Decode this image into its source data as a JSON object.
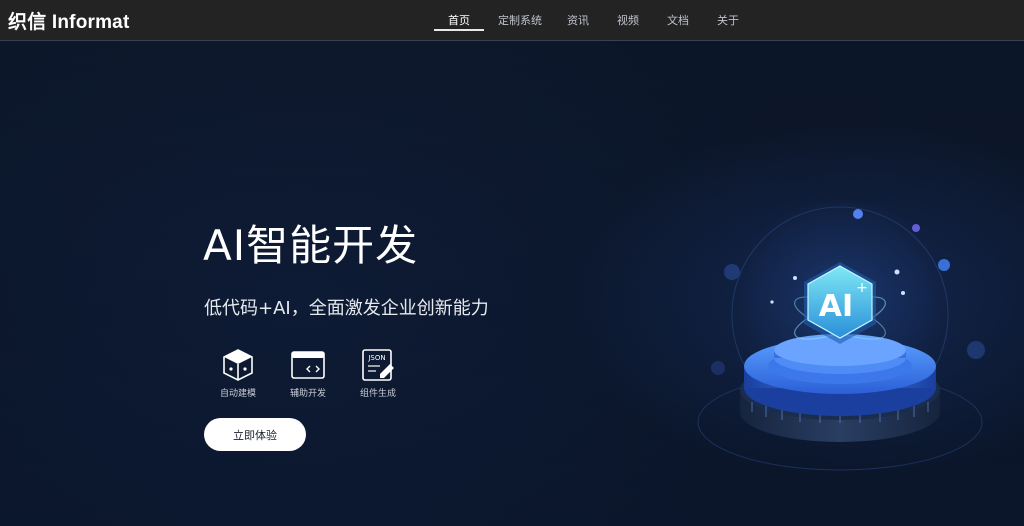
{
  "brand": {
    "logo_text": "织信 Informat"
  },
  "nav": {
    "items": [
      {
        "label": "首页",
        "active": true
      },
      {
        "label": "定制系统",
        "active": false
      },
      {
        "label": "资讯",
        "active": false
      },
      {
        "label": "视频",
        "active": false
      },
      {
        "label": "文档",
        "active": false
      },
      {
        "label": "关于",
        "active": false
      }
    ]
  },
  "hero": {
    "title": "AI智能开发",
    "subtitle": "低代码+AI，全面激发企业创新能力",
    "features": [
      {
        "label": "自动建模",
        "icon": "cube-icon"
      },
      {
        "label": "辅助开发",
        "icon": "code-window-icon"
      },
      {
        "label": "组件生成",
        "icon": "json-doc-icon"
      }
    ],
    "cta_label": "立即体验",
    "badge_text": "AI",
    "badge_plus": "+"
  },
  "colors": {
    "background": "#0b1426",
    "navbar": "#232323",
    "accent_blue": "#2f6df0",
    "cta_bg": "#ffffff"
  }
}
